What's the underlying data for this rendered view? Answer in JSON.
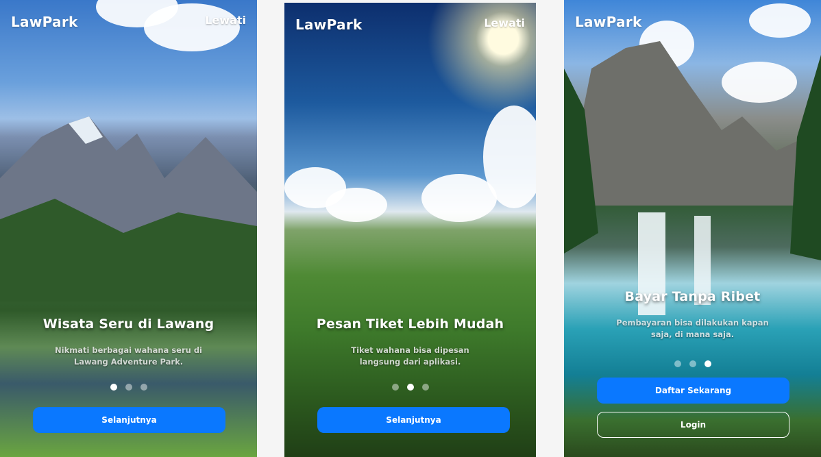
{
  "brand": "LawPark",
  "skip_label": "Lewati",
  "screens": [
    {
      "title": "Wisata Seru di Lawang",
      "description": "Nikmati berbagai wahana seru di Lawang Adventure Park.",
      "active_dot": 0,
      "primary_button": "Selanjutnya"
    },
    {
      "title": "Pesan Tiket Lebih Mudah",
      "description": "Tiket wahana bisa dipesan langsung dari aplikasi.",
      "active_dot": 1,
      "primary_button": "Selanjutnya"
    },
    {
      "title": "Bayar Tanpa Ribet",
      "description": "Pembayaran bisa dilakukan kapan saja, di mana saja.",
      "active_dot": 2,
      "primary_button": "Daftar Sekarang",
      "secondary_button": "Login"
    }
  ],
  "colors": {
    "primary_button": "#0a78ff",
    "page_background": "#f5f5f5"
  }
}
